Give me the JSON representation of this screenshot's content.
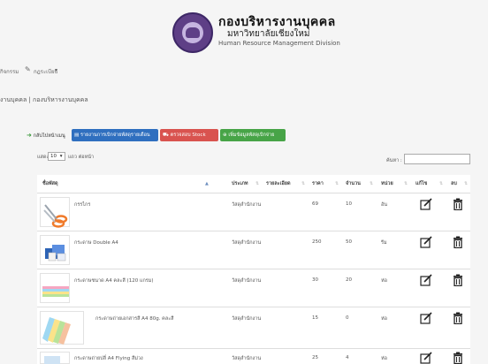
{
  "header": {
    "brand_line1": "กองบริหารงานบุคคล",
    "brand_line2": "มหาวิทยาลัยเชียงใหม่",
    "brand_line3": "Human Resource Management Division"
  },
  "nav": {
    "item1": "กิจกรรม",
    "item2": "กฎระเบียบ",
    "item2_caret": "▾"
  },
  "breadcrumb": "งานบุคคล | กองบริหารงานบุคคล",
  "actions": {
    "back": "กลับไปหน้าเมนู",
    "report": "รายงานการเบิกจ่ายพัสดุรายเดือน",
    "stock": "ตรวจสอบ Stock",
    "add": "เพิ่มข้อมูลพัสดุเบิกจ่าย"
  },
  "length": {
    "show": "แสดง",
    "value": "10",
    "caret": "▾",
    "per_page": "แถว ต่อหน้า"
  },
  "search": {
    "label": "ค้นหา :",
    "value": ""
  },
  "columns": [
    "ชื่อพัสดุ",
    "ประเภท",
    "รายละเอียด",
    "ราคา",
    "จำนวน",
    "หน่วย",
    "แก้ไข",
    "ลบ"
  ],
  "rows": [
    {
      "name": "กรรไกร",
      "type": "วัสดุสำนักงาน",
      "detail": "",
      "price": "69",
      "qty": "10",
      "unit": "อัน"
    },
    {
      "name": "กระดาษ Double A4",
      "type": "วัสดุสำนักงาน",
      "detail": "",
      "price": "250",
      "qty": "50",
      "unit": "รีม"
    },
    {
      "name": "กระดาษชนาด A4 คละสี (120 แกรม)",
      "type": "วัสดุสำนักงาน",
      "detail": "",
      "price": "30",
      "qty": "20",
      "unit": "ห่อ"
    },
    {
      "name": "กระดาษถ่ายเอกสารสี A4 80g. คละสี",
      "type": "วัสดุสำนักงาน",
      "detail": "",
      "price": "15",
      "qty": "0",
      "unit": "ห่อ"
    },
    {
      "name": "กระดาษถ่ายปลี่ A4 Flying สีม่วง",
      "type": "วัสดุสำนักงาน",
      "detail": "",
      "price": "25",
      "qty": "4",
      "unit": "ห่อ"
    }
  ],
  "colors": {
    "blue_button": "#2f6fbf",
    "red_button": "#d9534f",
    "green_button": "#47a447",
    "logo_purple": "#5e3f86"
  }
}
